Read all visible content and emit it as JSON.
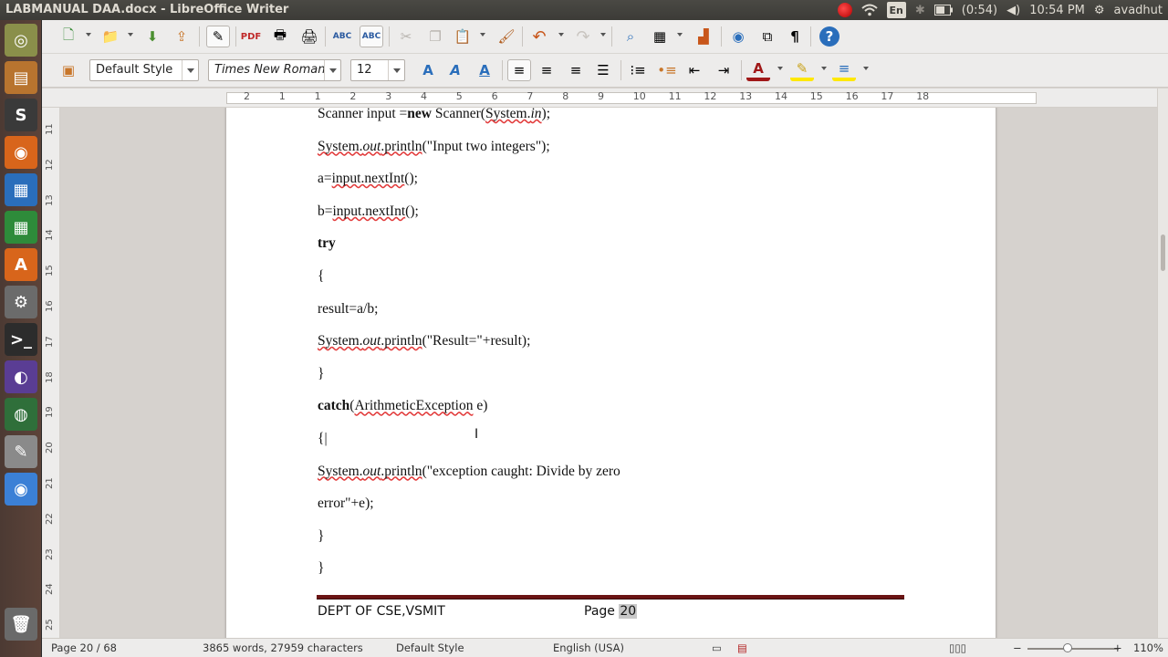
{
  "window": {
    "title": "LABMANUAL DAA.docx - LibreOffice Writer"
  },
  "tray": {
    "keyboard": "En",
    "battery": "(0:54)",
    "time": "10:54 PM",
    "user": "avadhut"
  },
  "launcher": {
    "items": [
      {
        "name": "dash-home-icon",
        "glyph": "◎",
        "color": "#8a8f4a"
      },
      {
        "name": "files-icon",
        "glyph": "▤",
        "color": "#b8742f"
      },
      {
        "name": "sublime-text-icon",
        "glyph": "S",
        "color": "#3a3a3a"
      },
      {
        "name": "firefox-icon",
        "glyph": "◉",
        "color": "#d8651b"
      },
      {
        "name": "writer-icon",
        "glyph": "▦",
        "color": "#2a6ebb"
      },
      {
        "name": "calc-icon",
        "glyph": "▦",
        "color": "#2e8b3a"
      },
      {
        "name": "software-center-icon",
        "glyph": "A",
        "color": "#d8651b"
      },
      {
        "name": "system-settings-icon",
        "glyph": "⚙",
        "color": "#6b6b6b"
      },
      {
        "name": "terminal-icon",
        "glyph": ">_",
        "color": "#2c2c2c"
      },
      {
        "name": "eclipse-icon",
        "glyph": "◐",
        "color": "#5a3d94"
      },
      {
        "name": "globe-icon",
        "glyph": "◍",
        "color": "#2f6f3a"
      },
      {
        "name": "text-editor-icon",
        "glyph": "✎",
        "color": "#8a8a8a"
      },
      {
        "name": "chrome-icon",
        "glyph": "◉",
        "color": "#3b80d6"
      },
      {
        "name": "trash-icon",
        "glyph": "🗑",
        "color": "#6a6a6a"
      }
    ]
  },
  "formatting": {
    "paragraph_style": "Default Style",
    "font_name": "Times New Roman",
    "font_size": "12"
  },
  "ruler": {
    "h_ticks": [
      "2",
      "1",
      "1",
      "2",
      "3",
      "4",
      "5",
      "6",
      "7",
      "8",
      "9",
      "10",
      "11",
      "12",
      "13",
      "14",
      "15",
      "16",
      "17",
      "18"
    ],
    "v_ticks": [
      "11",
      "12",
      "13",
      "14",
      "15",
      "16",
      "17",
      "18",
      "19",
      "20",
      "21",
      "22",
      "23",
      "24",
      "25"
    ]
  },
  "document": {
    "lines": [
      {
        "segments": [
          {
            "t": "Scanner input ="
          },
          {
            "t": "new",
            "b": true
          },
          {
            "t": " Scanner("
          },
          {
            "t": "System.",
            "sq": true
          },
          {
            "t": "in",
            "i": true,
            "sq": true
          },
          {
            "t": ");"
          }
        ]
      },
      {
        "segments": [
          {
            "t": "System.",
            "sq": true
          },
          {
            "t": "out",
            "i": true,
            "sq": true
          },
          {
            "t": ".println",
            "sq": true
          },
          {
            "t": "(\"Input two integers\");"
          }
        ]
      },
      {
        "segments": [
          {
            "t": "a="
          },
          {
            "t": "input.nextInt",
            "sq": true
          },
          {
            "t": "();"
          }
        ]
      },
      {
        "segments": [
          {
            "t": "b="
          },
          {
            "t": "input.nextInt",
            "sq": true
          },
          {
            "t": "();"
          }
        ]
      },
      {
        "segments": [
          {
            "t": "try",
            "b": true
          }
        ]
      },
      {
        "segments": [
          {
            "t": "{"
          }
        ]
      },
      {
        "segments": [
          {
            "t": "result=a/b;"
          }
        ]
      },
      {
        "segments": [
          {
            "t": "System.",
            "sq": true
          },
          {
            "t": "out",
            "i": true,
            "sq": true
          },
          {
            "t": ".println",
            "sq": true
          },
          {
            "t": "(\"Result=\"+result);"
          }
        ]
      },
      {
        "segments": [
          {
            "t": "}"
          }
        ]
      },
      {
        "segments": [
          {
            "t": "catch",
            "b": true
          },
          {
            "t": "("
          },
          {
            "t": "ArithmeticException",
            "sq": true
          },
          {
            "t": " e)"
          }
        ]
      },
      {
        "segments": [
          {
            "t": "{|"
          }
        ]
      },
      {
        "segments": [
          {
            "t": "System.",
            "sq": true
          },
          {
            "t": "out",
            "i": true,
            "sq": true
          },
          {
            "t": ".println",
            "sq": true
          },
          {
            "t": "(\"exception caught: Divide by zero"
          }
        ]
      },
      {
        "segments": [
          {
            "t": "error\"+e);"
          }
        ]
      },
      {
        "segments": [
          {
            "t": "}"
          }
        ]
      },
      {
        "segments": [
          {
            "t": "}"
          }
        ]
      }
    ],
    "footer_left": "DEPT OF CSE,VSMIT",
    "footer_page_label": "Page ",
    "footer_page_number": "20"
  },
  "status": {
    "page": "Page 20 / 68",
    "words": "3865 words, 27959 characters",
    "style": "Default Style",
    "language": "English (USA)",
    "zoom": "110%"
  }
}
